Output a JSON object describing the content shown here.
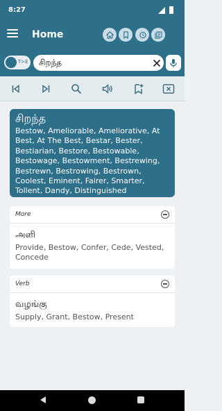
{
  "status": {
    "time": "8:27"
  },
  "appbar": {
    "title": "Home"
  },
  "search": {
    "toggle_label": "T>E",
    "value": "சிறந்த",
    "placeholder": ""
  },
  "result": {
    "word": "சிறந்த",
    "synonyms": "Bestow, Ameliorable, Ameliorative, At Best, At The Best, Bestar, Bester, Bestiarian, Bestore, Bestowable, Bestowage, Bestowment, Bestrewing, Bestrewn, Bestrowing, Bestrown, Coolest, Eminent, Fairer, Smarter, Tollent, Dandy, Distinguished"
  },
  "sections": [
    {
      "label": "More",
      "term": "அளி",
      "meanings": "Provide, Bestow, Confer, Cede, Vested, Concede"
    },
    {
      "label": "Verb",
      "term": "வழங்கு",
      "meanings": "Supply, Grant, Bestow, Present"
    }
  ],
  "colors": {
    "primary": "#2e6f8a",
    "background": "#eef1f3",
    "toolbar": "#e4ecef"
  },
  "icons": {
    "appbar": [
      "home-icon",
      "bookmark-icon",
      "history-icon",
      "favorites-icon"
    ],
    "toolbar": [
      "skip-previous-icon",
      "skip-next-icon",
      "search-icon",
      "volume-icon",
      "bookmark-add-icon",
      "clear-box-icon"
    ]
  }
}
